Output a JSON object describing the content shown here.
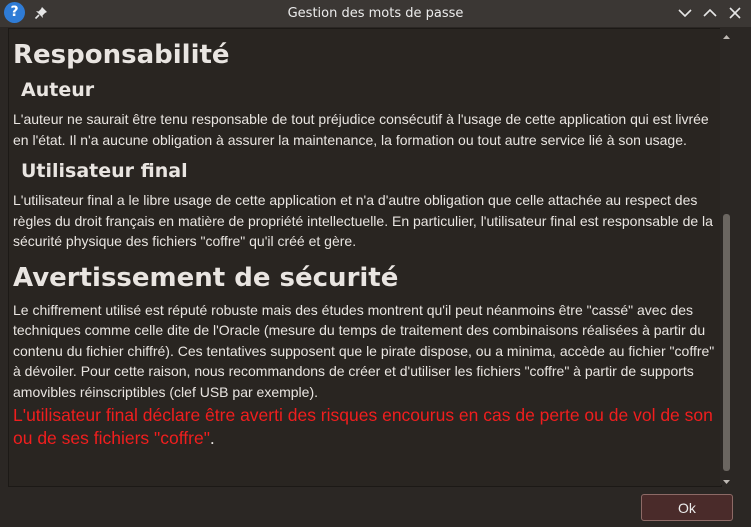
{
  "window": {
    "title": "Gestion des mots de passe",
    "help_glyph": "?",
    "icons": [
      "help-icon",
      "pin-icon",
      "chevron-down-icon",
      "chevron-up-icon",
      "close-icon"
    ]
  },
  "content": {
    "h1_responsabilite": "Responsabilité",
    "h2_auteur": "Auteur",
    "p_auteur": "L'auteur ne saurait être tenu responsable de tout préjudice consécutif à l'usage de cette application qui est livrée en l'état. Il n'a aucune obligation à assurer la maintenance, la formation ou tout autre service lié à son usage.",
    "h2_utilisateur": "Utilisateur final",
    "p_utilisateur": "L'utilisateur final a le libre usage de cette application et n'a d'autre obligation que celle attachée au respect des règles du droit français en matière de propriété intellectuelle. En particulier, l'utilisateur final est responsable de la sécurité physique des fichiers \"coffre\" qu'il créé et gère.",
    "h1_avertissement": "Avertissement de sécurité",
    "p_avertissement": "Le chiffrement utilisé est réputé robuste mais des études montrent qu'il peut néanmoins être \"cassé\" avec des techniques comme celle dite de l'Oracle (mesure du temps de traitement des combinaisons réalisées à partir du contenu du fichier chiffré). Ces tentatives supposent que le pirate dispose, ou a minima, accède au fichier \"coffre\" à dévoiler. Pour cette raison, nous recommandons de créer et d'utiliser les fichiers \"coffre\" à partir de supports amovibles réinscriptibles (clef USB par exemple).",
    "warning_red": "L'utilisateur final déclare être averti des risques encourus en cas de perte ou de vol de son ou de ses fichiers \"coffre\"",
    "warning_end": "."
  },
  "scrollbar": {
    "scroll_position": 0.41
  },
  "buttons": {
    "ok": "Ok"
  },
  "colors": {
    "background": "#2b2724",
    "text": "#e9e5e1",
    "warning": "#f01e1e",
    "ok_button": "#4a2b2a",
    "help_icon": "#2f7cd6"
  }
}
